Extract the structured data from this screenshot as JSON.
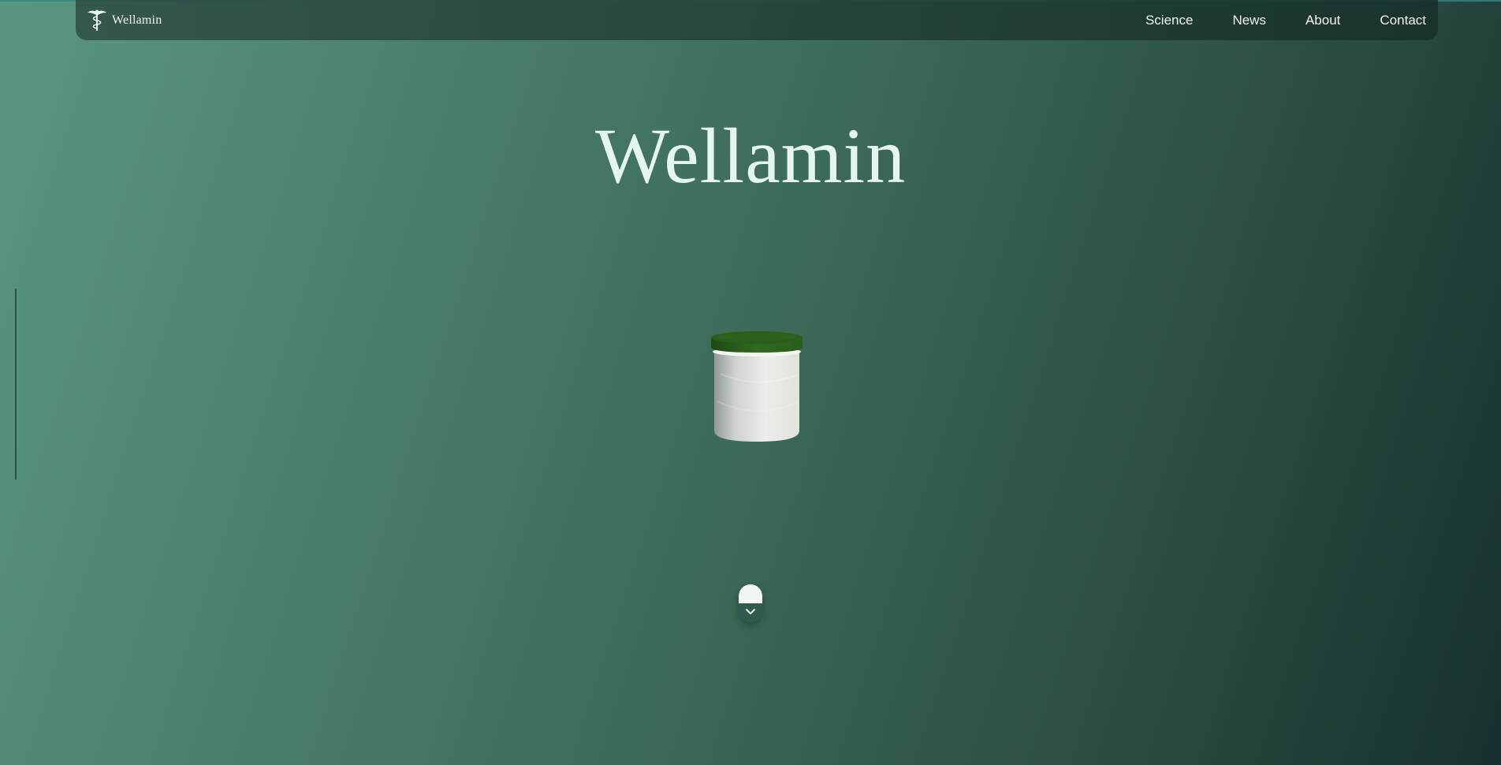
{
  "brand": {
    "name": "Wellamin",
    "icon": "caduceus-icon"
  },
  "nav": {
    "items": [
      {
        "label": "Science"
      },
      {
        "label": "News"
      },
      {
        "label": "About"
      },
      {
        "label": "Contact"
      }
    ]
  },
  "hero": {
    "title": "Wellamin",
    "product_image": "supplement-jar",
    "scroll_icon": "chevron-down-icon"
  },
  "colors": {
    "background_start": "#5a9680",
    "background_end": "#17302f",
    "title": "#e5f6ef",
    "jar_lid": "#2c5e1a",
    "jar_body": "#e8e8e4"
  }
}
